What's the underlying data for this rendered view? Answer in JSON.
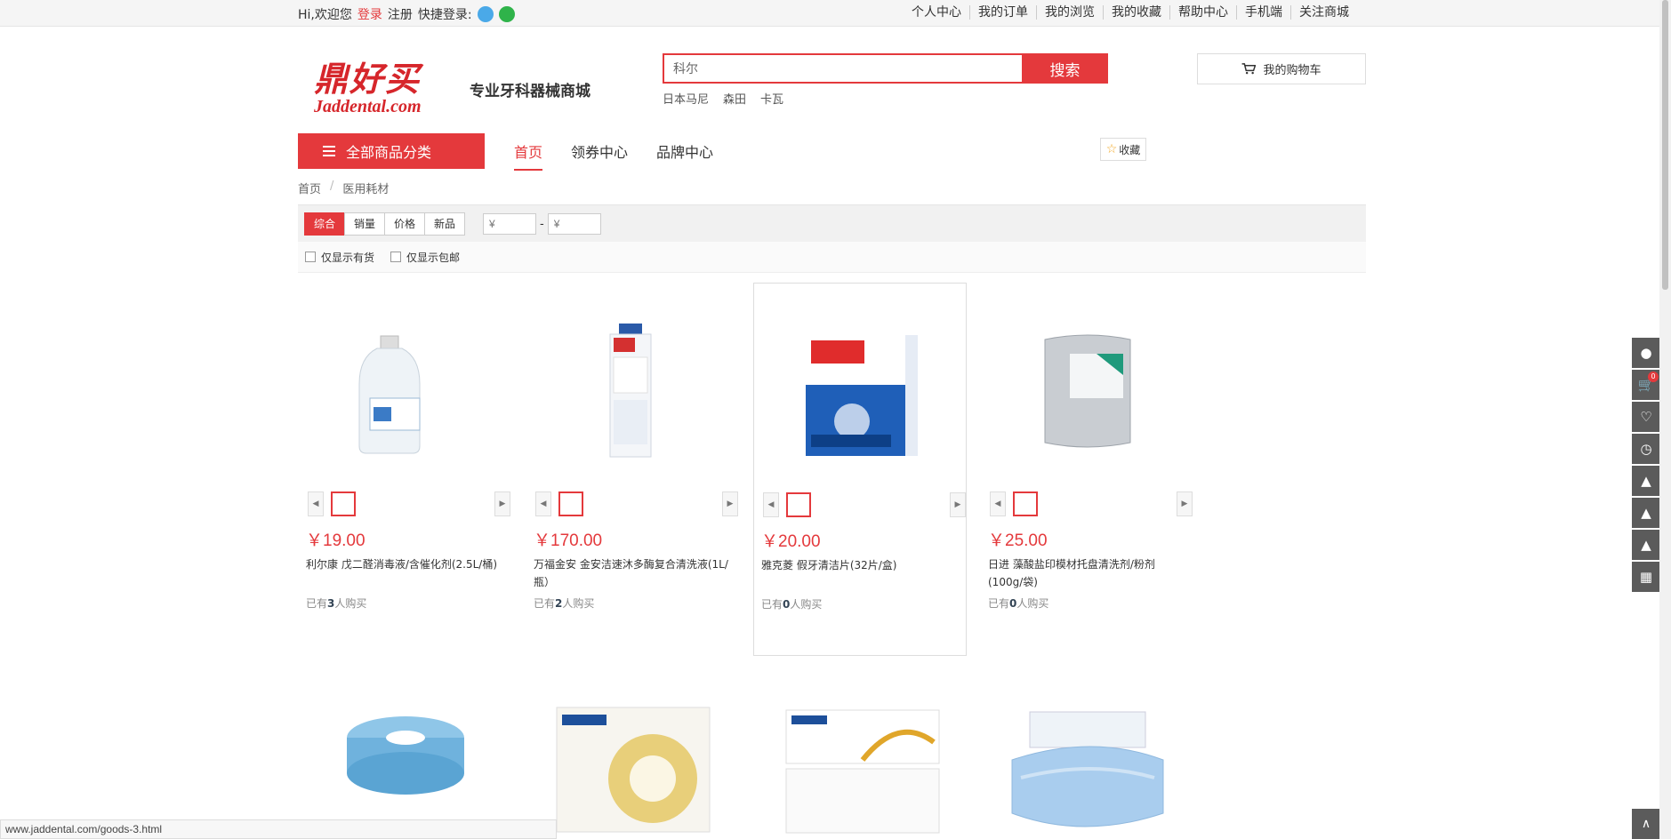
{
  "topbar": {
    "greeting": "Hi,欢迎您",
    "login": "登录",
    "register": "注册",
    "quick_login": "快捷登录:",
    "links": [
      "个人中心",
      "我的订单",
      "我的浏览",
      "我的收藏",
      "帮助中心",
      "手机端",
      "关注商城"
    ]
  },
  "header": {
    "logo_cn": "鼎好买",
    "logo_en": "Jaddental.com",
    "slogan": "专业牙科器械商城",
    "search_value": "科尔",
    "search_button": "搜索",
    "hotwords": [
      "日本马尼",
      "森田",
      "卡瓦"
    ],
    "cart_label": "我的购物车"
  },
  "nav": {
    "all_categories": "全部商品分类",
    "links": [
      "首页",
      "领券中心",
      "品牌中心"
    ],
    "favorite": "收藏"
  },
  "breadcrumb": [
    "首页",
    "医用耗材"
  ],
  "filter": {
    "sorts": [
      "综合",
      "销量",
      "价格",
      "新品"
    ],
    "price_from_placeholder": "¥",
    "price_to_placeholder": "¥",
    "price_dash": "-",
    "only_in_stock": "仅显示有货",
    "only_free_shipping": "仅显示包邮"
  },
  "products": [
    {
      "price": "￥19.00",
      "name": "利尔康 戊二醛消毒液/含催化剂(2.5L/桶)",
      "sold_prefix": "已有",
      "sold_count": "3",
      "sold_suffix": "人购买"
    },
    {
      "price": "￥170.00",
      "name": "万福金安 金安洁速沐多酶复合清洗液(1L/瓶）",
      "sold_prefix": "已有",
      "sold_count": "2",
      "sold_suffix": "人购买"
    },
    {
      "price": "￥20.00",
      "name": "雅克菱 假牙清洁片(32片/盒)",
      "sold_prefix": "已有",
      "sold_count": "0",
      "sold_suffix": "人购买"
    },
    {
      "price": "￥25.00",
      "name": "日进 藻酸盐印模材托盘清洗剂/粉剂(100g/袋)",
      "sold_prefix": "已有",
      "sold_count": "0",
      "sold_suffix": "人购买"
    }
  ],
  "toolbar": {
    "cart_badge": "0",
    "icons": [
      "user-icon",
      "cart-icon",
      "heart-icon",
      "clock-icon",
      "qq-icon",
      "qq-icon",
      "qq-icon",
      "qrcode-icon",
      "arrow-up-icon"
    ]
  },
  "status_url": "www.jaddental.com/goods-3.html",
  "colors": {
    "accent": "#e4393c",
    "toolbar": "#5b5b5b"
  }
}
